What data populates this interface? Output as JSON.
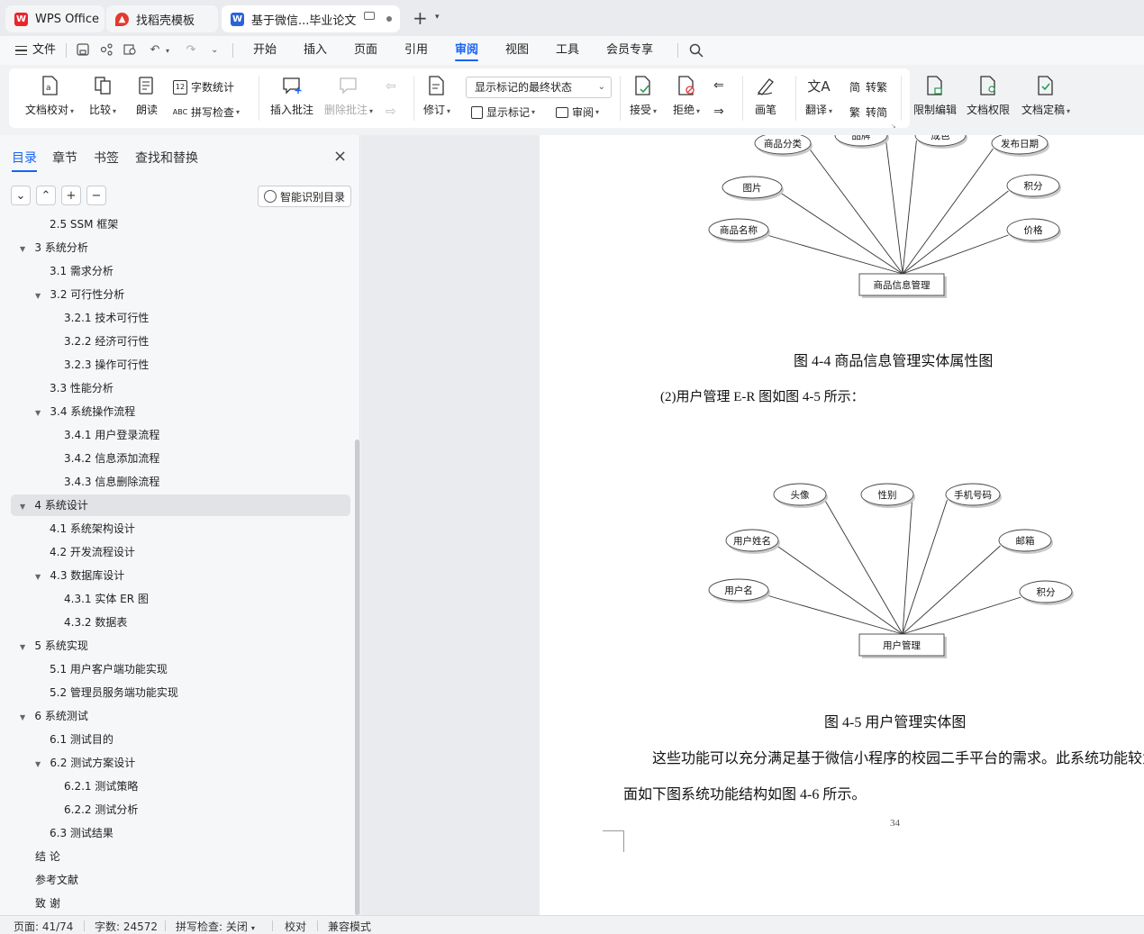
{
  "tabs": {
    "wps": "WPS Office",
    "template": "找稻壳模板",
    "doc": "基于微信...毕业论文"
  },
  "menu": {
    "file": "文件",
    "items": [
      "开始",
      "插入",
      "页面",
      "引用",
      "审阅",
      "视图",
      "工具",
      "会员专享"
    ],
    "active": "审阅"
  },
  "ribbon": {
    "proofread": "文档校对",
    "compare": "比较",
    "read_aloud": "朗读",
    "word_count": "字数统计",
    "spell_check": "拼写检查",
    "insert_comment": "插入批注",
    "delete_comment": "删除批注",
    "revise": "修订",
    "markup_state": "显示标记的最终状态",
    "show_markup": "显示标记",
    "review": "审阅",
    "accept": "接受",
    "reject": "拒绝",
    "pen": "画笔",
    "translate": "翻译",
    "to_traditional": "转繁",
    "to_simplified": "转简",
    "restrict_edit": "限制编辑",
    "doc_permission": "文档权限",
    "finalize": "文档定稿"
  },
  "left_panel": {
    "tabs": [
      "目录",
      "章节",
      "书签",
      "查找和替换"
    ],
    "smart_toc": "智能识别目录",
    "toc": [
      {
        "label": "2.5 SSM 框架",
        "level": 2,
        "arrow": false
      },
      {
        "label": "3  系统分析",
        "level": 1,
        "arrow": true
      },
      {
        "label": "3.1 需求分析",
        "level": 2,
        "arrow": false
      },
      {
        "label": "3.2 可行性分析",
        "level": 2,
        "arrow": true
      },
      {
        "label": "3.2.1 技术可行性",
        "level": 3,
        "arrow": false
      },
      {
        "label": "3.2.2 经济可行性",
        "level": 3,
        "arrow": false
      },
      {
        "label": "3.2.3 操作可行性",
        "level": 3,
        "arrow": false
      },
      {
        "label": "3.3 性能分析",
        "level": 2,
        "arrow": false
      },
      {
        "label": "3.4 系统操作流程",
        "level": 2,
        "arrow": true
      },
      {
        "label": "3.4.1 用户登录流程",
        "level": 3,
        "arrow": false
      },
      {
        "label": "3.4.2 信息添加流程",
        "level": 3,
        "arrow": false
      },
      {
        "label": "3.4.3 信息删除流程",
        "level": 3,
        "arrow": false
      },
      {
        "label": "4  系统设计",
        "level": 1,
        "arrow": true,
        "selected": true
      },
      {
        "label": "4.1 系统架构设计",
        "level": 2,
        "arrow": false
      },
      {
        "label": "4.2 开发流程设计",
        "level": 2,
        "arrow": false
      },
      {
        "label": "4.3 数据库设计",
        "level": 2,
        "arrow": true
      },
      {
        "label": "4.3.1 实体 ER 图",
        "level": 3,
        "arrow": false
      },
      {
        "label": "4.3.2 数据表",
        "level": 3,
        "arrow": false
      },
      {
        "label": "5  系统实现",
        "level": 1,
        "arrow": true
      },
      {
        "label": "5.1 用户客户端功能实现",
        "level": 2,
        "arrow": false
      },
      {
        "label": "5.2  管理员服务端功能实现",
        "level": 2,
        "arrow": false
      },
      {
        "label": "6  系统测试",
        "level": 1,
        "arrow": true
      },
      {
        "label": "6.1  测试目的",
        "level": 2,
        "arrow": false
      },
      {
        "label": "6.2  测试方案设计",
        "level": 2,
        "arrow": true
      },
      {
        "label": "6.2.1  测试策略",
        "level": 3,
        "arrow": false
      },
      {
        "label": "6.2.2  测试分析",
        "level": 3,
        "arrow": false
      },
      {
        "label": "6.3  测试结果",
        "level": 2,
        "arrow": false
      },
      {
        "label": "结   论",
        "level": 1,
        "arrow": false
      },
      {
        "label": "参考文献",
        "level": 1,
        "arrow": false
      },
      {
        "label": "致   谢",
        "level": 1,
        "arrow": false
      }
    ]
  },
  "document": {
    "er1": {
      "center": "商品信息管理",
      "attrs": [
        "商品名称",
        "图片",
        "商品分类",
        "品牌",
        "成色",
        "发布日期",
        "积分",
        "价格"
      ]
    },
    "fig1_caption": "图 4-4  商品信息管理实体属性图",
    "para1": "(2)用户管理 E-R 图如图 4-5 所示：",
    "er2": {
      "center": "用户管理",
      "attrs": [
        "用户名",
        "用户姓名",
        "头像",
        "性别",
        "手机号码",
        "邮箱",
        "积分"
      ]
    },
    "fig2_caption": "图 4-5 用户管理实体图",
    "para2": "这些功能可以充分满足基于微信小程序的校园二手平台的需求。此系统功能较为",
    "para3": "面如下图系统功能结构如图 4-6 所示。",
    "page_number": "34"
  },
  "status": {
    "page": "页面: 41/74",
    "words": "字数: 24572",
    "spell": "拼写检查: 关闭",
    "proof": "校对",
    "compat": "兼容模式"
  }
}
